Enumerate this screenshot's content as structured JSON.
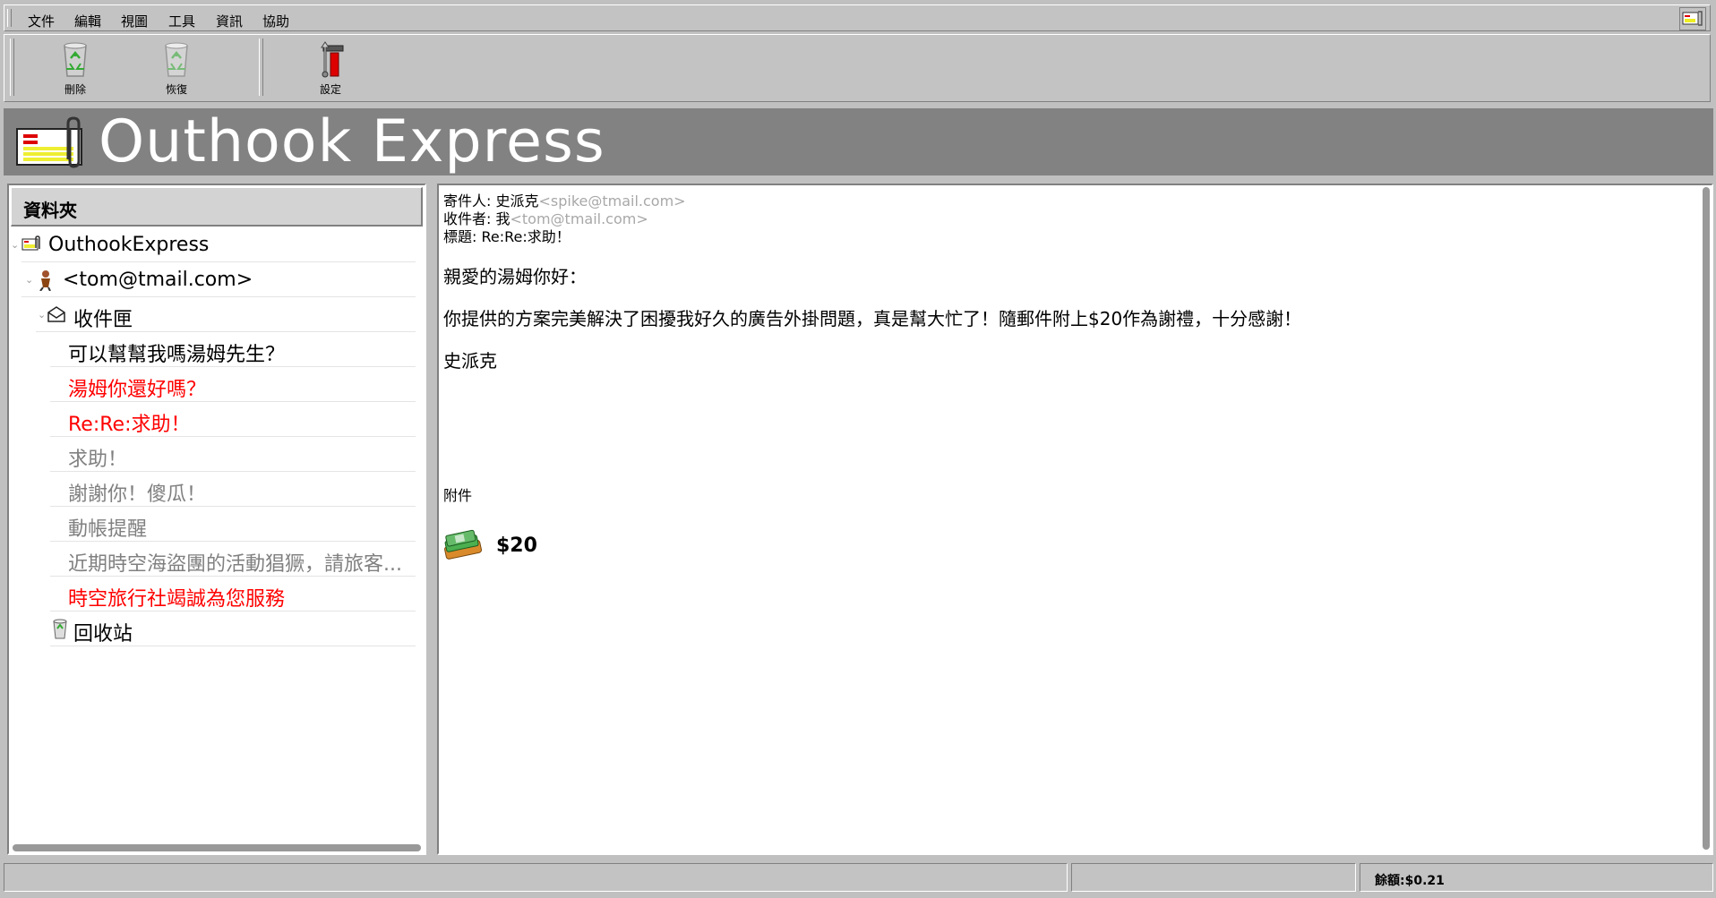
{
  "menu": [
    "文件",
    "編輯",
    "視圖",
    "工具",
    "資訊",
    "協助"
  ],
  "toolbar": {
    "delete_label": "刪除",
    "restore_label": "恢復",
    "settings_label": "設定"
  },
  "banner": {
    "title": "Outhook Express"
  },
  "folders": {
    "header": "資料夾",
    "root": "OuthookExpress",
    "account": "<tom@tmail.com>",
    "inbox": "收件匣",
    "messages": [
      {
        "subject": "可以幫幫我嗎湯姆先生？",
        "color": "#000000"
      },
      {
        "subject": "湯姆你還好嗎？",
        "color": "#ff0000"
      },
      {
        "subject": "Re:Re:求助！",
        "color": "#ff0000"
      },
      {
        "subject": "求助！",
        "color": "#808080"
      },
      {
        "subject": "謝謝你！傻瓜！",
        "color": "#808080"
      },
      {
        "subject": "動帳提醒",
        "color": "#808080"
      },
      {
        "subject": "近期時空海盜團的活動猖獗，請旅客...",
        "color": "#808080"
      },
      {
        "subject": "時空旅行社竭誠為您服務",
        "color": "#ff0000"
      }
    ],
    "recycle": "回收站"
  },
  "message": {
    "from_label": "寄件人: 史派克",
    "from_email": "<spike@tmail.com>",
    "to_label": "收件者: 我",
    "to_email": "<tom@tmail.com>",
    "subject_line": "標題: Re:Re:求助！",
    "greeting": "親愛的湯姆你好：",
    "body": "你提供的方案完美解決了困擾我好久的廣告外掛問題，真是幫大忙了！隨郵件附上$20作為謝禮，十分感謝！",
    "signature": "史派克",
    "attachments_label": "附件",
    "attachment_amount": "$20"
  },
  "status": {
    "balance": "餘額:$0.21"
  },
  "colors": {
    "banner_bg": "#828282",
    "chrome_bg": "#c0c0c0",
    "unread": "#ff0000",
    "read": "#808080"
  }
}
